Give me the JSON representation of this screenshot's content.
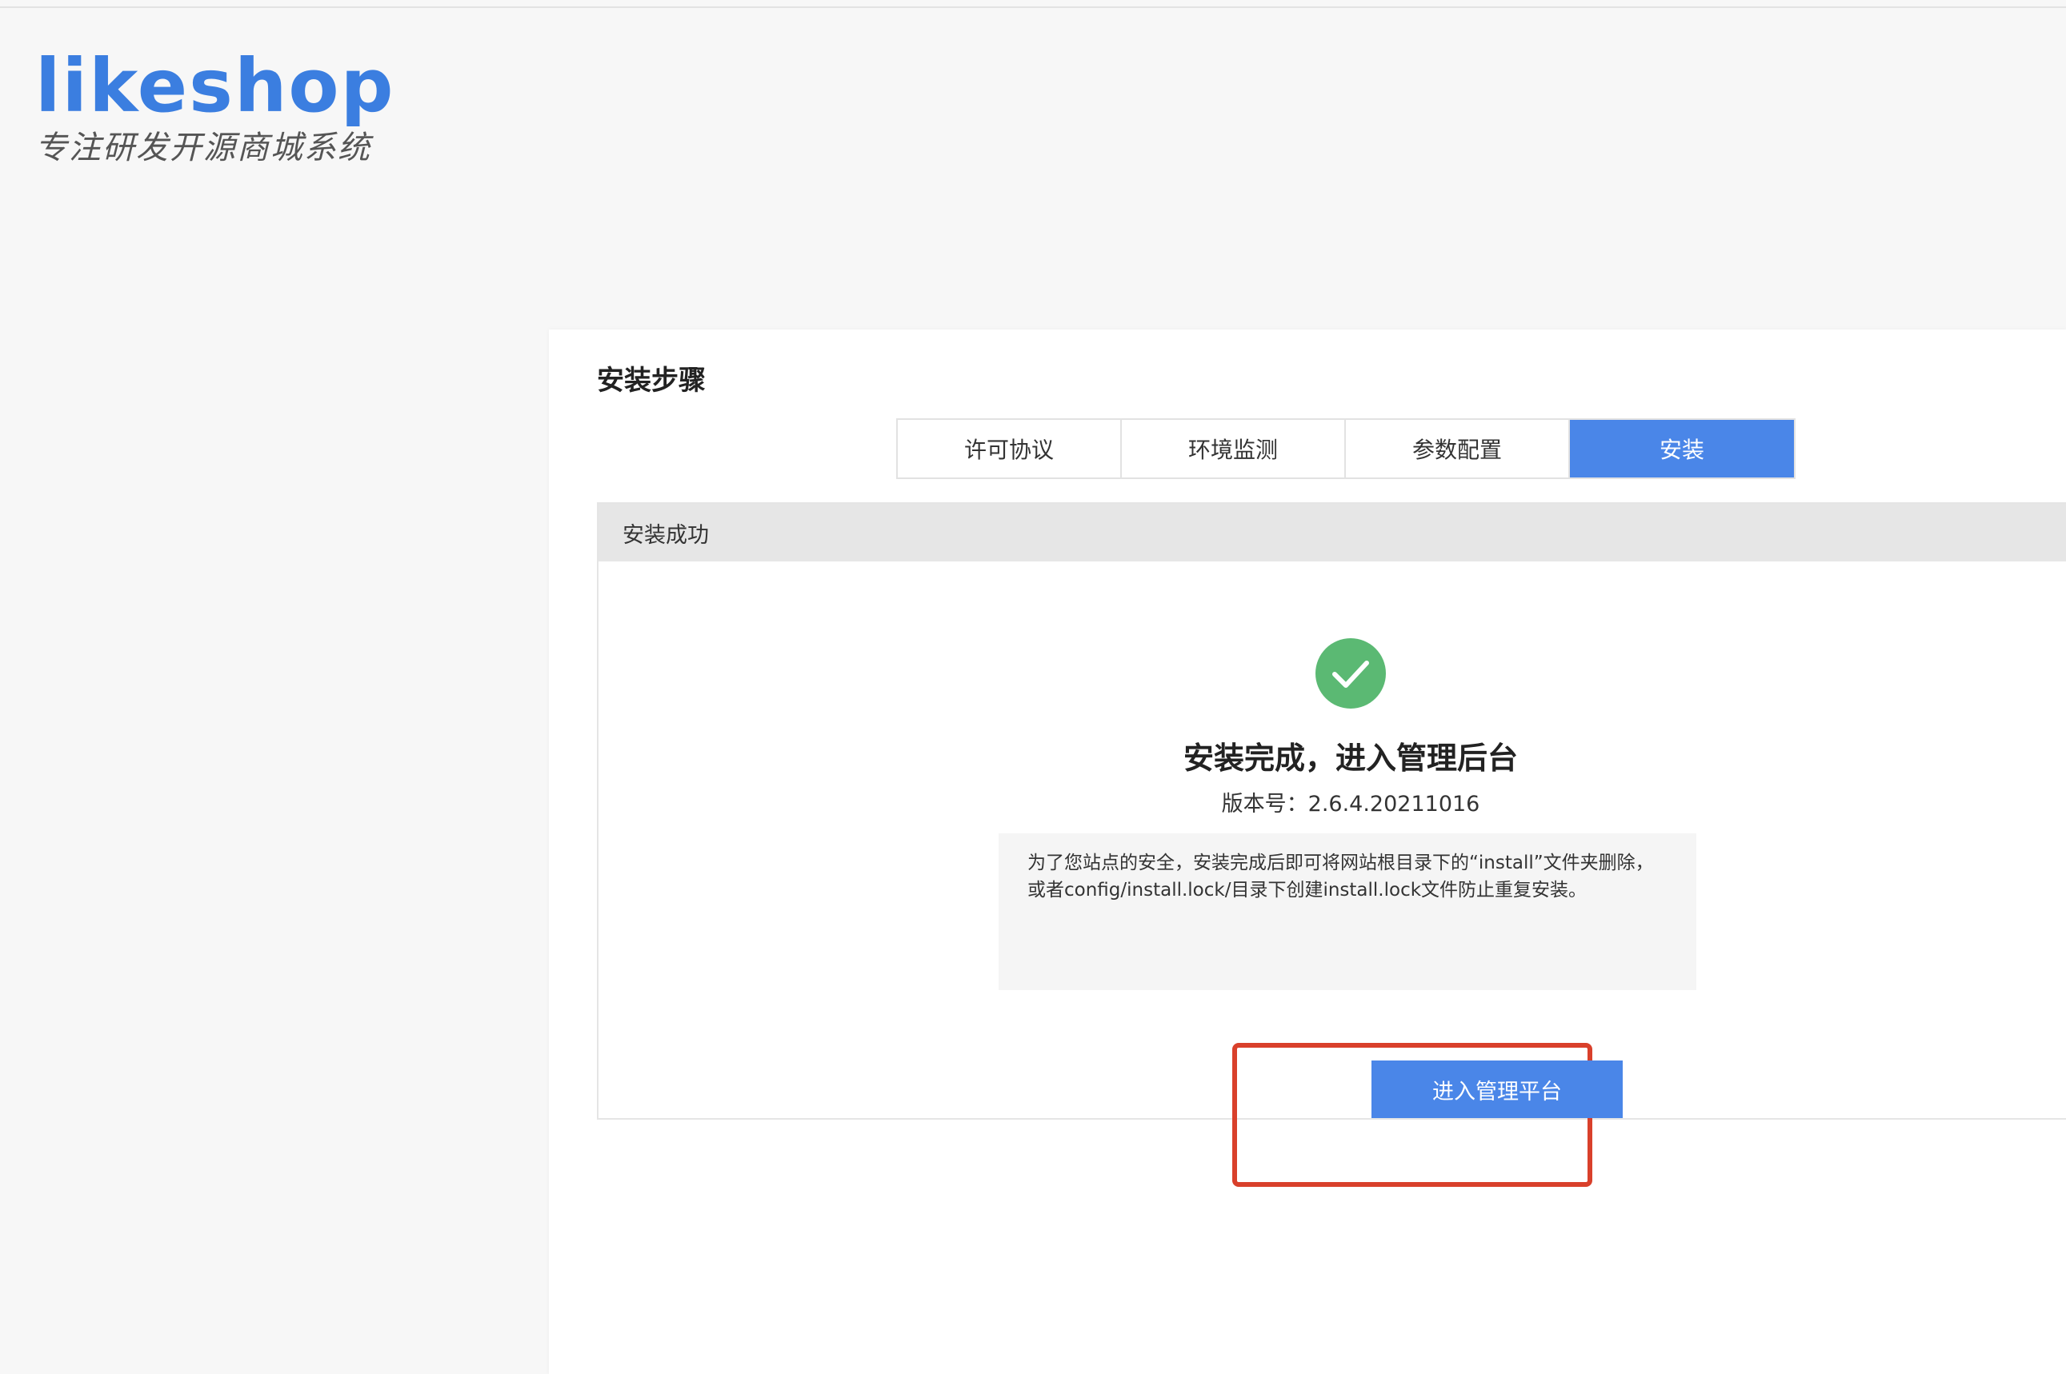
{
  "logo": {
    "brand": "likeshop",
    "slogan": "专注研发开源商城系统"
  },
  "card": {
    "title": "安装步骤"
  },
  "steps": [
    {
      "label": "许可协议",
      "active": false
    },
    {
      "label": "环境监测",
      "active": false
    },
    {
      "label": "参数配置",
      "active": false
    },
    {
      "label": "安装",
      "active": true
    }
  ],
  "panel": {
    "header": "安装成功",
    "success_icon": "check-circle-icon",
    "success_title": "安装完成，进入管理后台",
    "version_line": "版本号：2.6.4.20211016",
    "notice": "为了您站点的安全，安装完成后即可将网站根目录下的“install”文件夹删除，或者config/install.lock/目录下创建install.lock文件防止重复安装。",
    "enter_button": "进入管理平台"
  },
  "colors": {
    "accent": "#4a86e8",
    "success": "#5bb973",
    "highlight": "#d9402b"
  }
}
